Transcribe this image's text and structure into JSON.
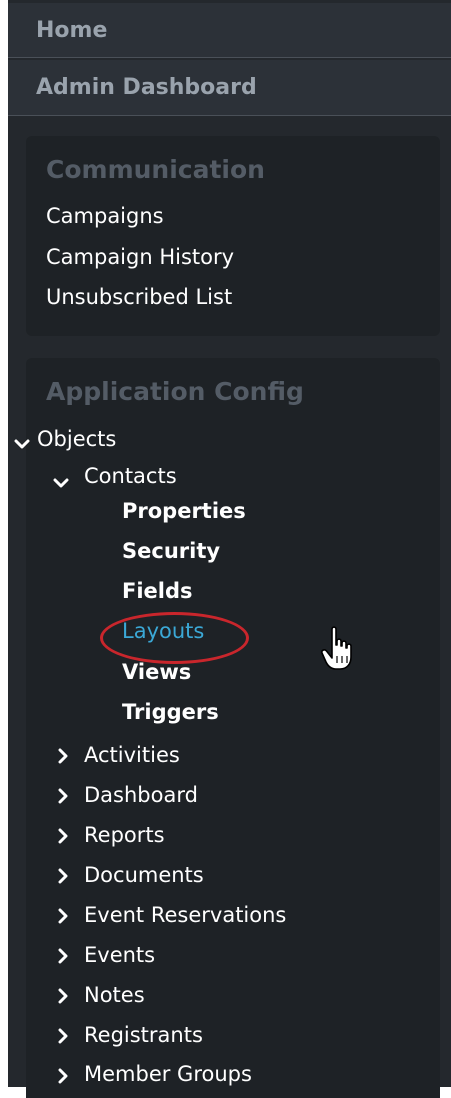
{
  "nav": {
    "home": "Home",
    "admin_dashboard": "Admin Dashboard"
  },
  "communication": {
    "title": "Communication",
    "items": [
      "Campaigns",
      "Campaign History",
      "Unsubscribed List"
    ]
  },
  "app_config": {
    "title": "Application Config",
    "objects_label": "Objects",
    "contacts_label": "Contacts",
    "contact_children": [
      "Properties",
      "Security",
      "Fields",
      "Layouts",
      "Views",
      "Triggers"
    ],
    "active_child": "Layouts",
    "collapsed_objects": [
      "Activities",
      "Dashboard",
      "Reports",
      "Documents",
      "Event Reservations",
      "Events",
      "Notes",
      "Registrants",
      "Member Groups"
    ]
  },
  "colors": {
    "sidebar_bg": "#24282d",
    "active_link": "#3ba8d6",
    "highlight_circle": "#c9262c"
  },
  "icons": {
    "expanded": "chevron-down-icon",
    "collapsed": "chevron-right-icon",
    "cursor": "hand-pointer-icon"
  }
}
